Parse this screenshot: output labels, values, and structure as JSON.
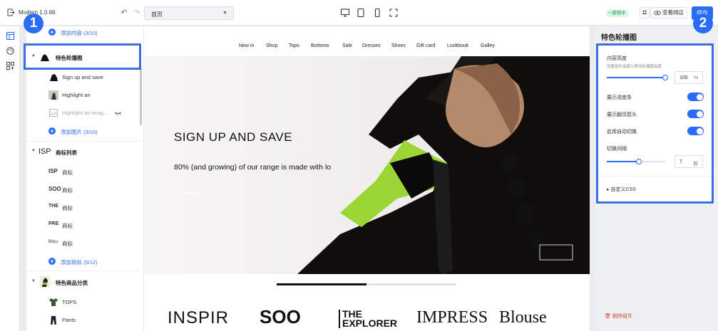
{
  "topbar": {
    "title": "Modern 1.0.66",
    "page_select": "首页",
    "status_badge": "• 使用中",
    "view_store": "查看网店",
    "save": "保存"
  },
  "sections": {
    "add_content": "添加内容 (3/10)",
    "slideshow": {
      "label": "特色轮播图",
      "items": [
        "Sign up and save",
        "Highlight an",
        "Highlight an imag..."
      ],
      "add": "添加图片 (3/10)"
    },
    "logo_list": {
      "label": "商标列表",
      "items": [
        "商标",
        "商标",
        "商标",
        "商标",
        "商标"
      ],
      "logo_marks": [
        "ISP",
        "SOO",
        "THE",
        "PRE",
        "Blou"
      ],
      "add": "添加商标 (5/12)"
    },
    "featured_collection": {
      "label": "特色商品分类",
      "items": [
        "TOPS",
        "Pants"
      ]
    }
  },
  "markers": [
    "1",
    "2"
  ],
  "preview": {
    "nav": [
      "New in",
      "Shop",
      "Tops",
      "Bottoms",
      "Sale",
      "Dresses",
      "Shoes",
      "Gift card",
      "Lookbook",
      "Galley"
    ],
    "hero_title": "SIGN UP AND SAVE",
    "hero_subtitle": "80% (and growing) of our range is made with lo",
    "hero_button": "SHOP NOW",
    "slide_progress": 0.5,
    "logos": [
      "INSPIR",
      "SOO",
      "THE EXPLORER",
      "IMPRESS",
      "Blouse"
    ]
  },
  "panel": {
    "title": "特色轮播图",
    "content_height_label": "内容高度",
    "content_height_hint": "设置组件高度以更改轮播图高度",
    "content_height_value": "100",
    "content_height_unit": "%",
    "content_height_level": 1.0,
    "show_progress": "展示进度条",
    "show_arrows": "展示翻页箭头",
    "autoplay": "启用自动切换",
    "interval_label": "切换间隔",
    "interval_value": "7",
    "interval_unit": "秒",
    "interval_level": 0.55,
    "custom_css": "▸ 自定义CSS",
    "delete": "删除组件"
  },
  "colors": {
    "accent": "#2b6cf6",
    "highlight": "#3b6fe0",
    "danger": "#e0443a",
    "success": "#1a9a4b"
  }
}
